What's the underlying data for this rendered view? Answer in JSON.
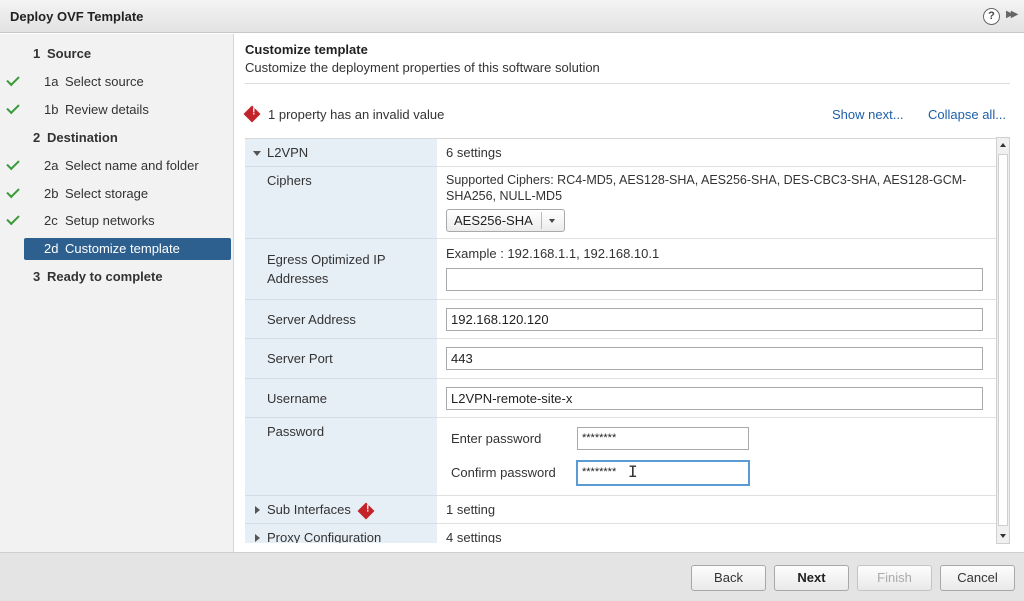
{
  "window": {
    "title": "Deploy OVF Template"
  },
  "sidebar": {
    "steps": [
      {
        "num": "1",
        "label": "Source",
        "type": "section",
        "done": false
      },
      {
        "num": "1a",
        "label": "Select source",
        "type": "sub",
        "done": true
      },
      {
        "num": "1b",
        "label": "Review details",
        "type": "sub",
        "done": true
      },
      {
        "num": "2",
        "label": "Destination",
        "type": "section",
        "done": false
      },
      {
        "num": "2a",
        "label": "Select name and folder",
        "type": "sub",
        "done": true
      },
      {
        "num": "2b",
        "label": "Select storage",
        "type": "sub",
        "done": true
      },
      {
        "num": "2c",
        "label": "Setup networks",
        "type": "sub",
        "done": true
      },
      {
        "num": "2d",
        "label": "Customize template",
        "type": "sub",
        "done": false,
        "active": true
      },
      {
        "num": "3",
        "label": "Ready to complete",
        "type": "section",
        "done": false
      }
    ]
  },
  "main": {
    "title": "Customize template",
    "subtitle": "Customize the deployment properties of this software solution",
    "warning": "1 property has an invalid value",
    "show_next": "Show next...",
    "collapse_all": "Collapse all...",
    "l2vpn": {
      "label": "L2VPN",
      "value": "6 settings"
    },
    "ciphers": {
      "label": "Ciphers",
      "desc_line1": "Supported Ciphers: RC4-MD5, AES128-SHA, AES256-SHA, DES-CBC3-SHA, AES128-GCM-",
      "desc_line2": "SHA256, NULL-MD5",
      "selected": "AES256-SHA"
    },
    "egress": {
      "label_line1": "Egress Optimized IP",
      "label_line2": "Addresses",
      "example": "Example : 192.168.1.1, 192.168.10.1",
      "value": ""
    },
    "server_address": {
      "label": "Server Address",
      "value": "192.168.120.120"
    },
    "server_port": {
      "label": "Server Port",
      "value": "443"
    },
    "username": {
      "label": "Username",
      "value": "L2VPN-remote-site-x"
    },
    "password": {
      "label": "Password",
      "enter_label": "Enter password",
      "enter_value": "********",
      "confirm_label": "Confirm password",
      "confirm_value": "********"
    },
    "sub_interfaces": {
      "label": "Sub Interfaces",
      "value": "1 setting"
    },
    "proxy": {
      "label": "Proxy Configuration",
      "value": "4 settings"
    }
  },
  "footer": {
    "back": "Back",
    "next": "Next",
    "finish": "Finish",
    "cancel": "Cancel"
  },
  "colors": {
    "active_step": "#2d5f8f",
    "check": "#3a9a3a",
    "error": "#c3242a",
    "link": "#1d5fa8",
    "focus": "#5b9bd5"
  }
}
